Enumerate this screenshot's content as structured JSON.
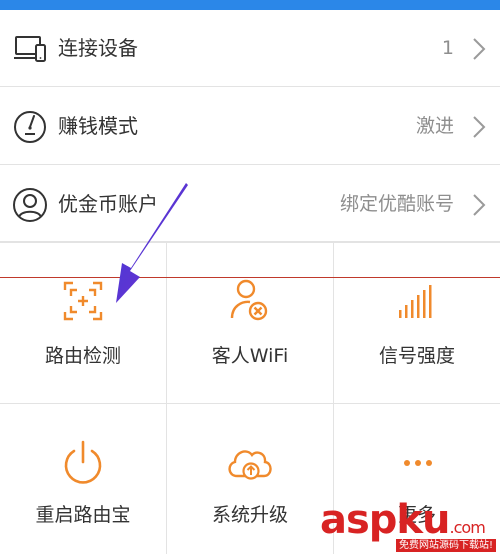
{
  "colors": {
    "accent": "#f08a2c",
    "statusbar": "#2b87e8",
    "arrow": "#3b3bd6",
    "watermark": "#d82323"
  },
  "list": [
    {
      "icon": "laptop-phone-icon",
      "label": "连接设备",
      "value": "1"
    },
    {
      "icon": "speedometer-icon",
      "label": "赚钱模式",
      "value": "激进"
    },
    {
      "icon": "user-account-icon",
      "label": "优金币账户",
      "value": "绑定优酷账号"
    }
  ],
  "grid": [
    {
      "icon": "route-scan-icon",
      "label": "路由检测"
    },
    {
      "icon": "guest-user-icon",
      "label": "客人WiFi"
    },
    {
      "icon": "signal-bars-icon",
      "label": "信号强度"
    },
    {
      "icon": "power-icon",
      "label": "重启路由宝"
    },
    {
      "icon": "cloud-upload-icon",
      "label": "系统升级"
    },
    {
      "icon": "more-dots-icon",
      "label": "更多"
    }
  ],
  "watermark": {
    "brand": "aspku",
    "domain": ".com",
    "tagline": "免费网站源码下载站!"
  }
}
